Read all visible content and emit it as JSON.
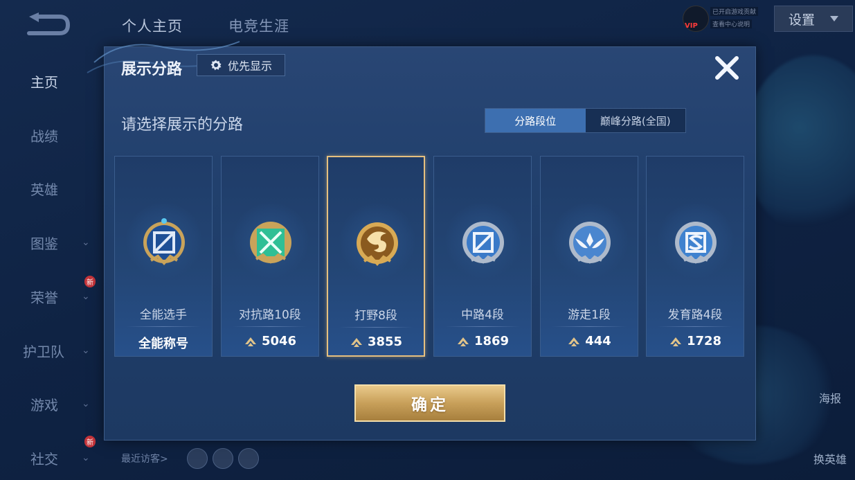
{
  "top_nav": {
    "tabs": [
      "个人主页",
      "电竞生涯"
    ]
  },
  "top_right": {
    "vip_label": "VIP",
    "mini_line_1": "已开启游戏贡献",
    "mini_line_2": "查看中心说明",
    "settings_label": "设置"
  },
  "sidebar": {
    "items": [
      {
        "label": "主页",
        "active": true
      },
      {
        "label": "战绩"
      },
      {
        "label": "英雄"
      },
      {
        "label": "图鉴",
        "expandable": true
      },
      {
        "label": "荣誉",
        "expandable": true,
        "badge": "新"
      },
      {
        "label": "护卫队",
        "expandable": true
      },
      {
        "label": "游戏",
        "expandable": true
      },
      {
        "label": "社交",
        "expandable": true,
        "badge": "新"
      }
    ]
  },
  "recent_visitors_label": "最近访客>",
  "right_side": {
    "poster_label": "海报",
    "change_hero_label": "换英雄"
  },
  "modal": {
    "title": "展示分路",
    "priority_label": "优先显示",
    "subtitle": "请选择展示的分路",
    "tabs": [
      {
        "label": "分路段位",
        "active": true
      },
      {
        "label": "巅峰分路(全国)",
        "active": false
      }
    ],
    "cards": [
      {
        "name": "全能选手",
        "value": "全能称号",
        "has_score_icon": false,
        "emblem": "all-round-emblem-icon",
        "selected": false
      },
      {
        "name": "对抗路10段",
        "value": "5046",
        "has_score_icon": true,
        "emblem": "clash-lane-emblem-icon",
        "selected": false
      },
      {
        "name": "打野8段",
        "value": "3855",
        "has_score_icon": true,
        "emblem": "jungle-dragon-emblem-icon",
        "selected": true
      },
      {
        "name": "中路4段",
        "value": "1869",
        "has_score_icon": true,
        "emblem": "mid-lane-emblem-icon",
        "selected": false
      },
      {
        "name": "游走1段",
        "value": "444",
        "has_score_icon": true,
        "emblem": "roam-wings-emblem-icon",
        "selected": false
      },
      {
        "name": "发育路4段",
        "value": "1728",
        "has_score_icon": true,
        "emblem": "farm-lane-emblem-icon",
        "selected": false
      }
    ],
    "confirm_label": "确定"
  },
  "colors": {
    "gold_accent": "#e6c07f",
    "tab_active": "#3d6fb0",
    "emblem_green": "#35c7a0",
    "emblem_blue": "#3a7ac8",
    "emblem_silver": "#b7c3d4"
  }
}
